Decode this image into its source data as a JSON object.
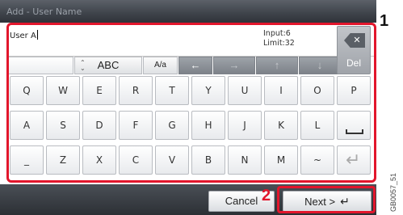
{
  "window": {
    "title": "Add - User Name"
  },
  "input": {
    "value": "User A",
    "info_line1": "Input:6",
    "info_line2": "Limit:32"
  },
  "toolbar": {
    "mode_label": "ABC",
    "case_label": "A/a",
    "del_label": "Del"
  },
  "keyboard": {
    "row1": [
      "Q",
      "W",
      "E",
      "R",
      "T",
      "Y",
      "U",
      "I",
      "O",
      "P"
    ],
    "row2": [
      "A",
      "S",
      "D",
      "F",
      "G",
      "H",
      "J",
      "K",
      "L"
    ],
    "row3": [
      "_",
      "Z",
      "X",
      "C",
      "V",
      "B",
      "N",
      "M",
      "~"
    ]
  },
  "buttons": {
    "cancel_label": "Cancel",
    "next_label": "Next >"
  },
  "callouts": {
    "one": "1",
    "two": "2"
  },
  "figure_code": "GB0057_51",
  "colors": {
    "highlight": "#e2162c",
    "bar": "#3e434a"
  }
}
